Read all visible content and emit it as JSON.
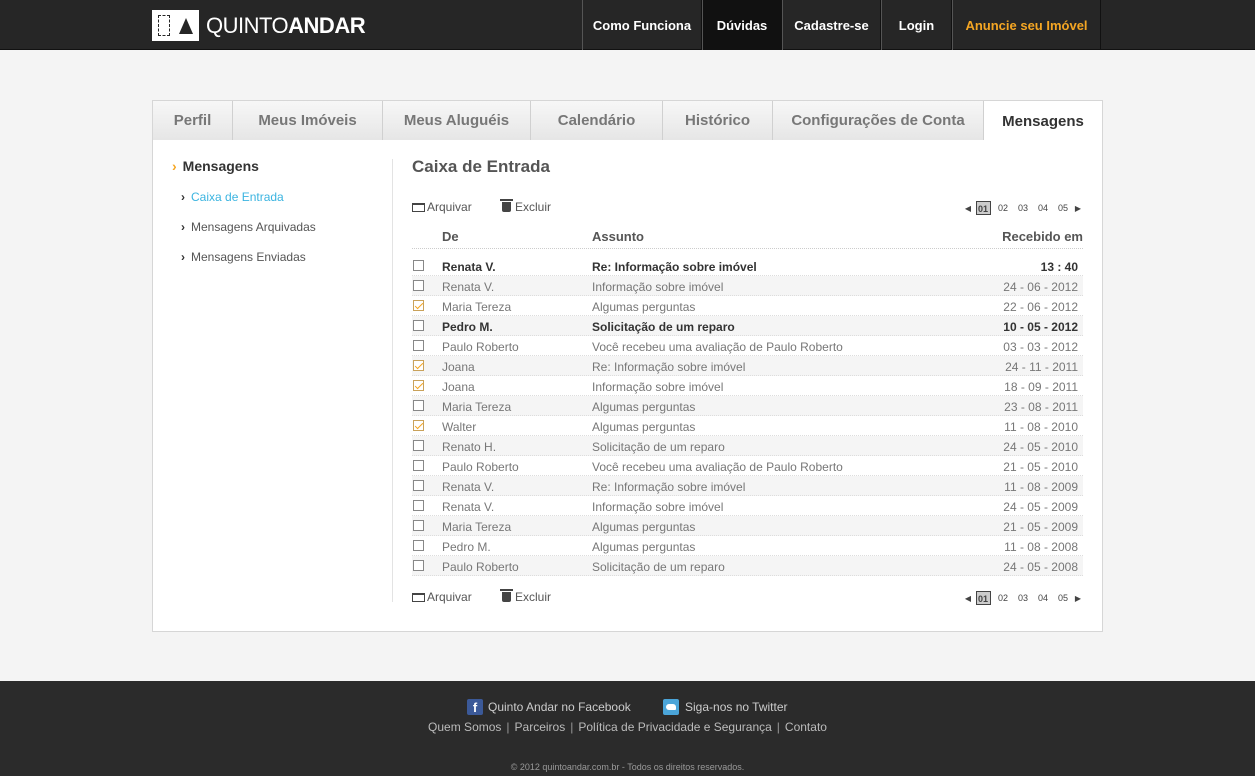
{
  "header": {
    "logo": {
      "light": "QUINTO",
      "bold": "ANDAR"
    },
    "nav": [
      {
        "label": "Como Funciona"
      },
      {
        "label": "Dúvidas"
      },
      {
        "label": "Cadastre-se"
      },
      {
        "label": "Login"
      },
      {
        "label": "Anuncie seu Imóvel"
      }
    ],
    "active_nav": "Dúvidas",
    "highlight_color": "#f5a623"
  },
  "tabs": [
    {
      "label": "Perfil"
    },
    {
      "label": "Meus Imóveis"
    },
    {
      "label": "Meus Aluguéis"
    },
    {
      "label": "Calendário"
    },
    {
      "label": "Histórico"
    },
    {
      "label": "Configurações de Conta"
    },
    {
      "label": "Mensagens"
    }
  ],
  "active_tab": "Mensagens",
  "sidebar": {
    "title": "Mensagens",
    "chevron": "›",
    "items": [
      {
        "label": "Caixa de Entrada",
        "active": true
      },
      {
        "label": "Mensagens Arquivadas",
        "active": false
      },
      {
        "label": "Mensagens Enviadas",
        "active": false
      }
    ]
  },
  "content": {
    "title": "Caixa de Entrada",
    "toolbar": {
      "archive_label": "Arquivar",
      "delete_label": "Excluir",
      "archive_icon": "folder-icon",
      "delete_icon": "trash-icon"
    },
    "pagination": {
      "prev": "◀",
      "next": "▶",
      "pages": [
        "01",
        "02",
        "03",
        "04",
        "05"
      ],
      "current": "01"
    },
    "columns": {
      "from": "De",
      "subject": "Assunto",
      "received": "Recebido em"
    },
    "messages": [
      {
        "from": "Renata V.",
        "subject": "Re: Informação sobre imóvel",
        "received": "13 : 40",
        "unread": true,
        "checked": false
      },
      {
        "from": "Renata V.",
        "subject": "Informação sobre imóvel",
        "received": "24 - 06 - 2012",
        "unread": false,
        "checked": false
      },
      {
        "from": "Maria Tereza",
        "subject": "Algumas perguntas",
        "received": "22 - 06 - 2012",
        "unread": false,
        "checked": true
      },
      {
        "from": "Pedro M.",
        "subject": "Solicitação de um reparo",
        "received": "10 - 05 - 2012",
        "unread": true,
        "checked": false
      },
      {
        "from": "Paulo Roberto",
        "subject": "Você recebeu uma avaliação de Paulo Roberto",
        "received": "03 - 03 - 2012",
        "unread": false,
        "checked": false
      },
      {
        "from": "Joana",
        "subject": "Re: Informação sobre imóvel",
        "received": "24 - 11 - 2011",
        "unread": false,
        "checked": true
      },
      {
        "from": "Joana",
        "subject": "Informação sobre imóvel",
        "received": "18 - 09 - 2011",
        "unread": false,
        "checked": true
      },
      {
        "from": "Maria Tereza",
        "subject": "Algumas perguntas",
        "received": "23 - 08 - 2011",
        "unread": false,
        "checked": false
      },
      {
        "from": "Walter",
        "subject": "Algumas perguntas",
        "received": "11 - 08 - 2010",
        "unread": false,
        "checked": true
      },
      {
        "from": "Renato H.",
        "subject": "Solicitação de um reparo",
        "received": "24 - 05 - 2010",
        "unread": false,
        "checked": false
      },
      {
        "from": "Paulo Roberto",
        "subject": "Você recebeu uma avaliação de Paulo Roberto",
        "received": "21 - 05 - 2010",
        "unread": false,
        "checked": false
      },
      {
        "from": "Renata V.",
        "subject": "Re: Informação sobre imóvel",
        "received": "11 - 08 - 2009",
        "unread": false,
        "checked": false
      },
      {
        "from": "Renata V.",
        "subject": "Informação sobre imóvel",
        "received": "24 - 05 - 2009",
        "unread": false,
        "checked": false
      },
      {
        "from": "Maria Tereza",
        "subject": "Algumas perguntas",
        "received": "21 - 05 - 2009",
        "unread": false,
        "checked": false
      },
      {
        "from": "Pedro M.",
        "subject": "Algumas perguntas",
        "received": "11 - 08 - 2008",
        "unread": false,
        "checked": false
      },
      {
        "from": "Paulo Roberto",
        "subject": "Solicitação de um reparo",
        "received": "24 - 05 - 2008",
        "unread": false,
        "checked": false
      }
    ]
  },
  "footer": {
    "facebook": {
      "label": "Quinto Andar no Facebook",
      "icon": "facebook-icon"
    },
    "twitter": {
      "label": "Siga-nos no Twitter",
      "icon": "twitter-icon"
    },
    "links": [
      "Quem Somos",
      "Parceiros",
      "Política de Privacidade e Segurança",
      "Contato"
    ],
    "separator": "|",
    "copyright": "© 2012 quintoandar.com.br - Todos os direitos reservados."
  }
}
